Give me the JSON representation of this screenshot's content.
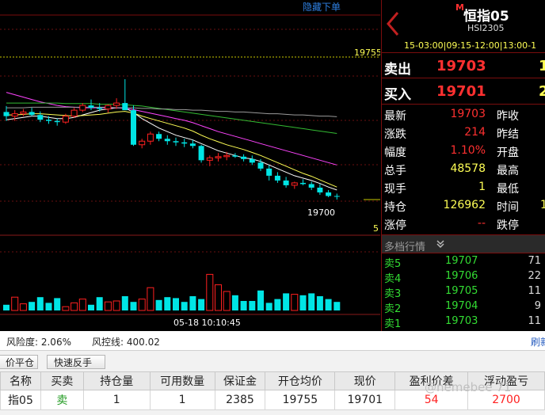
{
  "chart_panel": {
    "hide_order_label": "隐藏下单",
    "price_line_label": "19755",
    "price_line_value": 19755,
    "last_price_label": "19700",
    "edge_label": "5",
    "crosshair_time": "05-18 10:10:45"
  },
  "chart_data": {
    "type": "candlestick",
    "candles": [
      [
        19845,
        19855,
        19830,
        19838
      ],
      [
        19838,
        19848,
        19830,
        19842
      ],
      [
        19842,
        19850,
        19838,
        19845
      ],
      [
        19845,
        19852,
        19838,
        19840
      ],
      [
        19840,
        19846,
        19828,
        19832
      ],
      [
        19832,
        19838,
        19825,
        19830
      ],
      [
        19830,
        19834,
        19822,
        19828
      ],
      [
        19828,
        19842,
        19825,
        19838
      ],
      [
        19838,
        19852,
        19835,
        19848
      ],
      [
        19848,
        19860,
        19845,
        19856
      ],
      [
        19856,
        19866,
        19848,
        19852
      ],
      [
        19852,
        19860,
        19846,
        19850
      ],
      [
        19850,
        19858,
        19844,
        19856
      ],
      [
        19856,
        19868,
        19850,
        19860
      ],
      [
        19860,
        19900,
        19852,
        19848
      ],
      [
        19848,
        19856,
        19788,
        19790
      ],
      [
        19790,
        19800,
        19784,
        19796
      ],
      [
        19796,
        19812,
        19790,
        19808
      ],
      [
        19808,
        19812,
        19796,
        19800
      ],
      [
        19800,
        19806,
        19790,
        19796
      ],
      [
        19796,
        19802,
        19788,
        19794
      ],
      [
        19794,
        19800,
        19786,
        19792
      ],
      [
        19792,
        19798,
        19784,
        19788
      ],
      [
        19788,
        19790,
        19760,
        19764
      ],
      [
        19764,
        19772,
        19754,
        19768
      ],
      [
        19768,
        19776,
        19762,
        19770
      ],
      [
        19770,
        19778,
        19764,
        19772
      ],
      [
        19772,
        19776,
        19768,
        19770
      ],
      [
        19770,
        19774,
        19762,
        19766
      ],
      [
        19766,
        19772,
        19756,
        19760
      ],
      [
        19760,
        19766,
        19746,
        19750
      ],
      [
        19750,
        19756,
        19730,
        19738
      ],
      [
        19738,
        19744,
        19726,
        19730
      ],
      [
        19730,
        19736,
        19718,
        19722
      ],
      [
        19722,
        19728,
        19716,
        19726
      ],
      [
        19726,
        19732,
        19722,
        19724
      ],
      [
        19724,
        19728,
        19714,
        19718
      ],
      [
        19718,
        19724,
        19706,
        19710
      ],
      [
        19710,
        19714,
        19702,
        19704
      ],
      [
        19704,
        19708,
        19698,
        19703
      ]
    ],
    "ma": [
      {
        "name": "MA1",
        "color": "#ffffff",
        "values": [
          19832,
          19834,
          19836,
          19838,
          19838,
          19836,
          19834,
          19834,
          19836,
          19840,
          19844,
          19848,
          19850,
          19852,
          19852,
          19844,
          19834,
          19826,
          19818,
          19812,
          19806,
          19802,
          19798,
          19792,
          19786,
          19780,
          19776,
          19772,
          19768,
          19766,
          19762,
          19756,
          19750,
          19744,
          19738,
          19734,
          19730,
          19725,
          19719,
          19714
        ]
      },
      {
        "name": "MA2",
        "color": "#ffff55",
        "values": [
          19840,
          19840,
          19841,
          19842,
          19842,
          19841,
          19840,
          19839,
          19838,
          19839,
          19840,
          19841,
          19843,
          19845,
          19846,
          19843,
          19838,
          19834,
          19830,
          19826,
          19822,
          19818,
          19813,
          19806,
          19800,
          19795,
          19790,
          19786,
          19782,
          19777,
          19772,
          19766,
          19760,
          19754,
          19748,
          19742,
          19737,
          19731,
          19725,
          19719
        ]
      },
      {
        "name": "MA3",
        "color": "#ff44ff",
        "values": [
          19878,
          19874,
          19870,
          19866,
          19862,
          19859,
          19856,
          19854,
          19853,
          19852,
          19852,
          19852,
          19852,
          19852,
          19851,
          19849,
          19846,
          19843,
          19840,
          19837,
          19834,
          19831,
          19827,
          19822,
          19817,
          19812,
          19808,
          19804,
          19800,
          19796,
          19792,
          19788,
          19784,
          19780,
          19776,
          19772,
          19768,
          19764,
          19760,
          19756
        ]
      },
      {
        "name": "MA4",
        "color": "#33bb33",
        "values": [
          19860,
          19860,
          19860,
          19860,
          19860,
          19860,
          19860,
          19859,
          19859,
          19859,
          19859,
          19858,
          19858,
          19858,
          19857,
          19856,
          19855,
          19853,
          19851,
          19849,
          19847,
          19845,
          19843,
          19841,
          19839,
          19837,
          19835,
          19833,
          19831,
          19829,
          19827,
          19825,
          19823,
          19821,
          19819,
          19817,
          19815,
          19813,
          19811,
          19809
        ]
      },
      {
        "name": "MA5",
        "color": "#9a9a9a",
        "values": [
          19852,
          19852,
          19852,
          19853,
          19853,
          19853,
          19853,
          19853,
          19853,
          19853,
          19853,
          19853,
          19853,
          19852,
          19852,
          19852,
          19851,
          19851,
          19850,
          19850,
          19849,
          19849,
          19848,
          19848,
          19847,
          19846,
          19846,
          19845,
          19845,
          19844,
          19843,
          19842,
          19842,
          19841,
          19840,
          19840,
          19839,
          19838,
          19838,
          19837
        ]
      }
    ],
    "volumes": [
      6,
      14,
      7,
      9,
      14,
      8,
      13,
      4,
      8,
      12,
      6,
      14,
      9,
      10,
      15,
      9,
      12,
      24,
      11,
      14,
      13,
      9,
      15,
      12,
      38,
      27,
      20,
      16,
      10,
      10,
      21,
      8,
      12,
      18,
      17,
      16,
      18,
      15,
      12,
      9
    ]
  },
  "quote": {
    "back_icon": "chevron-left-icon",
    "badge": "M",
    "name": "恒指05",
    "code": "HSI2305",
    "sessions": "15-03:00|09:15-12:00|13:00-1",
    "ask_label": "卖出",
    "ask_price": "19703",
    "ask_extra": "1",
    "bid_label": "买入",
    "bid_price": "19701",
    "bid_extra": "2",
    "rows": [
      {
        "label": "最新",
        "value": "19703",
        "color": "#ff3030",
        "label2": "昨收"
      },
      {
        "label": "涨跌",
        "value": "214",
        "color": "#ff3030",
        "label2": "昨结"
      },
      {
        "label": "幅度",
        "value": "1.10%",
        "color": "#ff3030",
        "label2": "开盘"
      },
      {
        "label": "总手",
        "value": "48578",
        "color": "#ffff55",
        "label2": "最高"
      },
      {
        "label": "现手",
        "value": "1",
        "color": "#ffff55",
        "label2": "最低"
      },
      {
        "label": "持仓",
        "value": "126962",
        "color": "#ffff55",
        "label2": "时间",
        "extra": "1"
      },
      {
        "label": "涨停",
        "value": "--",
        "color": "#ff3030",
        "label2": "跌停"
      }
    ],
    "depth_title": "多档行情",
    "depth_icon": "double-chevron-down-icon",
    "depth": [
      {
        "label": "卖5",
        "price": "19707",
        "vol": "71"
      },
      {
        "label": "卖4",
        "price": "19706",
        "vol": "22"
      },
      {
        "label": "卖3",
        "price": "19705",
        "vol": "11"
      },
      {
        "label": "卖2",
        "price": "19704",
        "vol": "9"
      },
      {
        "label": "卖1",
        "price": "19703",
        "vol": "11"
      }
    ]
  },
  "account": {
    "risk_label": "风险度: 2.06%",
    "control_label": "风控线: 400.02",
    "refresh_label": "刷新",
    "close_button": "价平仓",
    "reverse_button": "快速反手"
  },
  "positions": {
    "headers": [
      "名称",
      "买卖",
      "持仓量",
      "可用数量",
      "保证金",
      "开仓均价",
      "现价",
      "盈利价差",
      "浮动盈亏"
    ],
    "rows": [
      {
        "name": "指05",
        "side": "卖",
        "qty": "1",
        "avail": "1",
        "margin": "2385",
        "open_avg": "19755",
        "current": "19701",
        "spread": "54",
        "pnl": "2700"
      }
    ]
  },
  "colors": {
    "up": "#ff2020",
    "down": "#00e5e5",
    "accent_red": "#ff3030",
    "yellow": "#ffff55",
    "green": "#33dd33"
  }
}
